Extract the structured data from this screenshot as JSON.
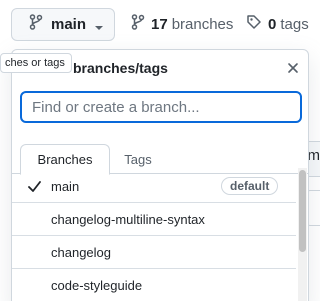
{
  "toolbar": {
    "branch_button_label": "main",
    "branches_count": "17",
    "branches_label": "branches",
    "tags_count": "0",
    "tags_label": "tags"
  },
  "tooltip": {
    "text": "ches or tags"
  },
  "panel": {
    "title": "branches/tags",
    "search_placeholder": "Find or create a branch...",
    "tabs": [
      {
        "label": "Branches",
        "active": true
      },
      {
        "label": "Tags",
        "active": false
      }
    ],
    "branches": [
      {
        "name": "main",
        "selected": true,
        "badge": "default"
      },
      {
        "name": "changelog-multiline-syntax"
      },
      {
        "name": "changelog"
      },
      {
        "name": "code-styleguide"
      }
    ]
  },
  "background": {
    "partial_letter": "m"
  },
  "icons": {
    "branch": "git-branch-icon",
    "caret": "caret-down-icon",
    "tag": "tag-icon",
    "close": "close-icon",
    "check": "check-icon"
  },
  "colors": {
    "focus_ring": "#0969da",
    "muted_text": "#57606a",
    "border": "#d0d7de"
  }
}
